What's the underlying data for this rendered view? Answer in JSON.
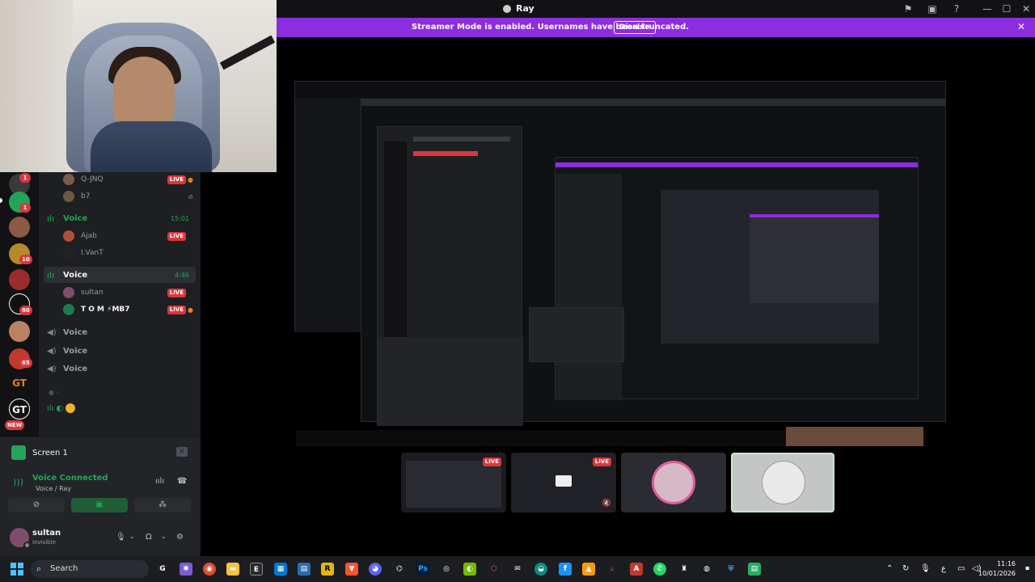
{
  "window": {
    "title": "Ray",
    "banner": {
      "message": "Streamer Mode is enabled. Usernames have been truncated.",
      "button": "Disable",
      "close": "✕"
    },
    "controls": [
      "—",
      "☐",
      "✕"
    ]
  },
  "servers": [
    {
      "badge": "1"
    },
    {
      "badge": "1"
    },
    {
      "badge": ""
    },
    {
      "badge": "10"
    },
    {
      "badge": ""
    },
    {
      "badge": "80"
    },
    {
      "badge": ""
    },
    {
      "badge": "65"
    },
    {
      "label": "GT"
    },
    {
      "label": "GT",
      "badge": "NEW"
    }
  ],
  "channels": {
    "top_users": [
      {
        "name": "Q-JNQ",
        "live": "LIVE"
      },
      {
        "name": "b7",
        "live": ""
      }
    ],
    "voice_1": {
      "name": "Voice",
      "time": "15:01"
    },
    "voice_1_users": [
      {
        "name": "Ajab",
        "live": "LIVE"
      },
      {
        "name": "I.VanT",
        "live": ""
      }
    ],
    "voice_2": {
      "name": "Voice",
      "time": "4:46"
    },
    "voice_2_users": [
      {
        "name": "sultan",
        "live": "LIVE"
      },
      {
        "name": "T O M ⚡MB7",
        "live": "LIVE"
      }
    ],
    "idle_voices": [
      "Voice",
      "Voice",
      "Voice"
    ]
  },
  "panel": {
    "screen_label": "Screen 1",
    "voice_status": "Voice Connected",
    "voice_channel": "Voice / Ray",
    "user_name": "sultan",
    "user_status": "Invisible"
  },
  "stream_tiles": [
    {
      "live": "LIVE"
    },
    {
      "live": "LIVE"
    },
    {
      "live": ""
    },
    {
      "live": ""
    }
  ],
  "taskbar": {
    "search": "Search",
    "time": "11:16",
    "date": "10/01/2026",
    "lang": "ع"
  },
  "colors": {
    "brand": "#8c2de0",
    "live": "#da373c",
    "connected": "#23a559"
  }
}
